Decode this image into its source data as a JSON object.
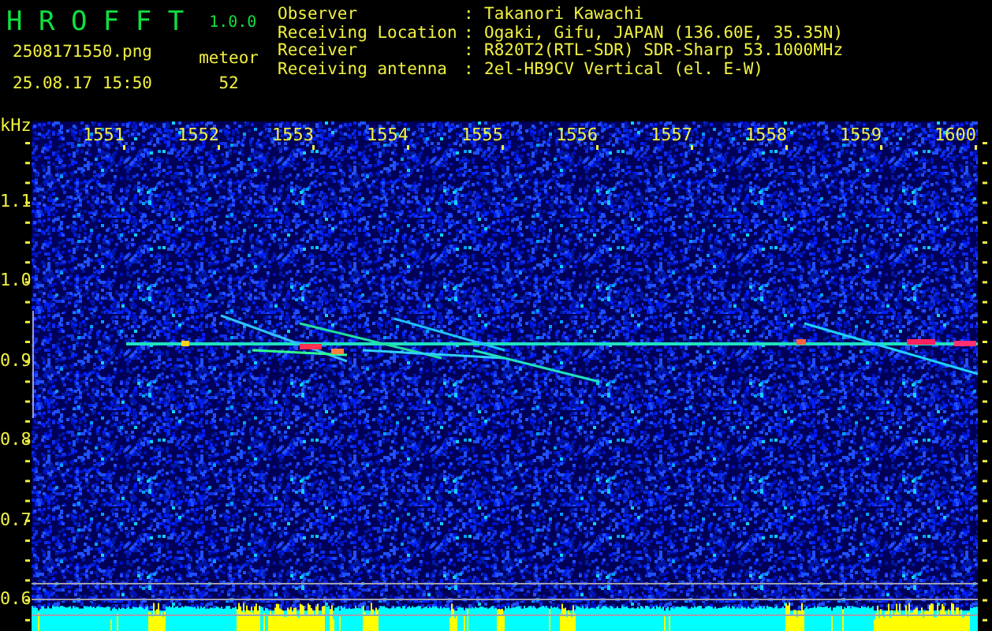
{
  "app": {
    "title": "H R O F F T",
    "version": "1.0.0"
  },
  "file": {
    "name": "2508171550.png",
    "timestamp": "25.08.17 15:50"
  },
  "meteor": {
    "label": "meteor",
    "count": "52"
  },
  "station": [
    {
      "label": "Observer",
      "separator": ":",
      "value": "Takanori Kawachi"
    },
    {
      "label": "Receiving Location",
      "separator": ":",
      "value": "Ogaki, Gifu, JAPAN (136.60E, 35.35N)"
    },
    {
      "label": "Receiver",
      "separator": ":",
      "value": "R820T2(RTL-SDR) SDR-Sharp 53.1000MHz"
    },
    {
      "label": "Receiving antenna",
      "separator": ":",
      "value": "2el-HB9CV Vertical (el. E-W)"
    }
  ],
  "spectrogram": {
    "y_unit": "kHz",
    "x_labels": [
      "1551",
      "1552",
      "1553",
      "1554",
      "1555",
      "1556",
      "1557",
      "1558",
      "1559",
      "1600"
    ],
    "y_labels": [
      "1.1",
      "1.0",
      "0.9",
      "0.8",
      "0.7",
      "0.6"
    ]
  }
}
